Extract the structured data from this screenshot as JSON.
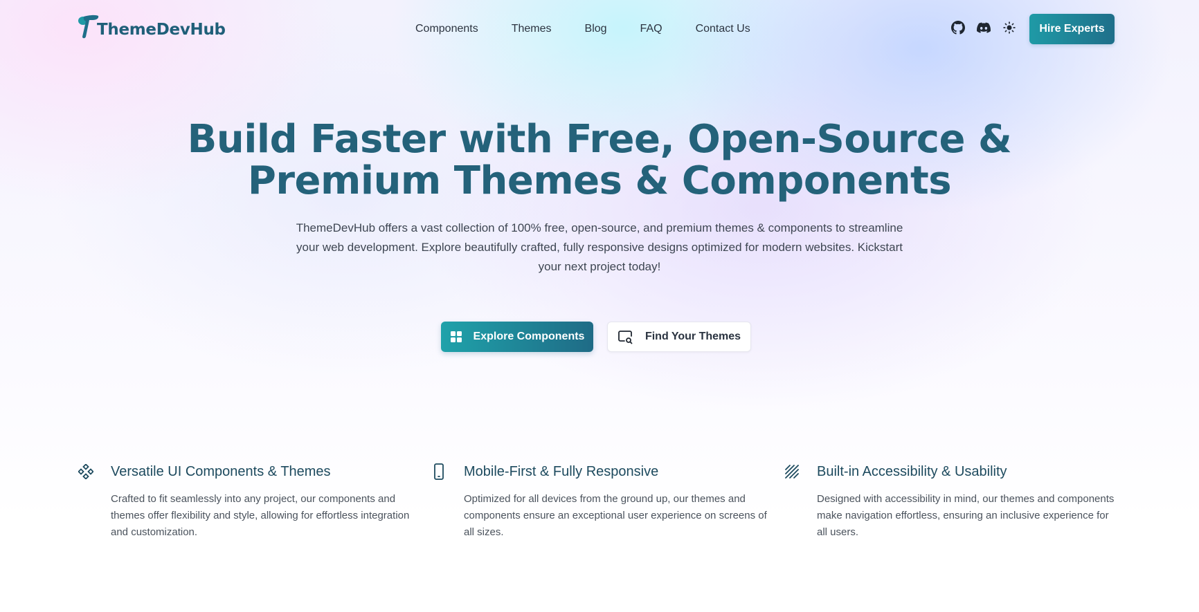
{
  "brand": {
    "name": "ThemeDevHub",
    "primary_color": "#24627a",
    "accent_color": "#1fa2aa"
  },
  "nav": {
    "links": [
      {
        "label": "Components"
      },
      {
        "label": "Themes"
      },
      {
        "label": "Blog"
      },
      {
        "label": "FAQ"
      },
      {
        "label": "Contact Us"
      }
    ],
    "icons": [
      "github-icon",
      "discord-icon",
      "sun-icon"
    ],
    "cta_label": "Hire Experts"
  },
  "hero": {
    "title_line1": "Build Faster with Free, Open-Source &",
    "title_line2": "Premium Themes & Components",
    "subtitle": "ThemeDevHub offers a vast collection of 100% free, open-source, and premium themes & components to streamline your web development. Explore beautifully crafted, fully responsive designs optimized for modern websites. Kickstart your next project today!",
    "primary_cta": {
      "label": "Explore Components",
      "icon": "grid-icon"
    },
    "secondary_cta": {
      "label": "Find Your Themes",
      "icon": "screen-search-icon"
    }
  },
  "features": [
    {
      "icon": "diamond-dots-icon",
      "title": "Versatile UI Components & Themes",
      "description": "Crafted to fit seamlessly into any project, our components and themes offer flexibility and style, allowing for effortless integration and customization."
    },
    {
      "icon": "mobile-phone-icon",
      "title": "Mobile-First & Fully Responsive",
      "description": "Optimized for all devices from the ground up, our themes and components ensure an exceptional user experience on screens of all sizes."
    },
    {
      "icon": "striped-square-icon",
      "title": "Built-in Accessibility & Usability",
      "description": "Designed with accessibility in mind, our themes and components make navigation effortless, ensuring an inclusive experience for all users."
    }
  ]
}
